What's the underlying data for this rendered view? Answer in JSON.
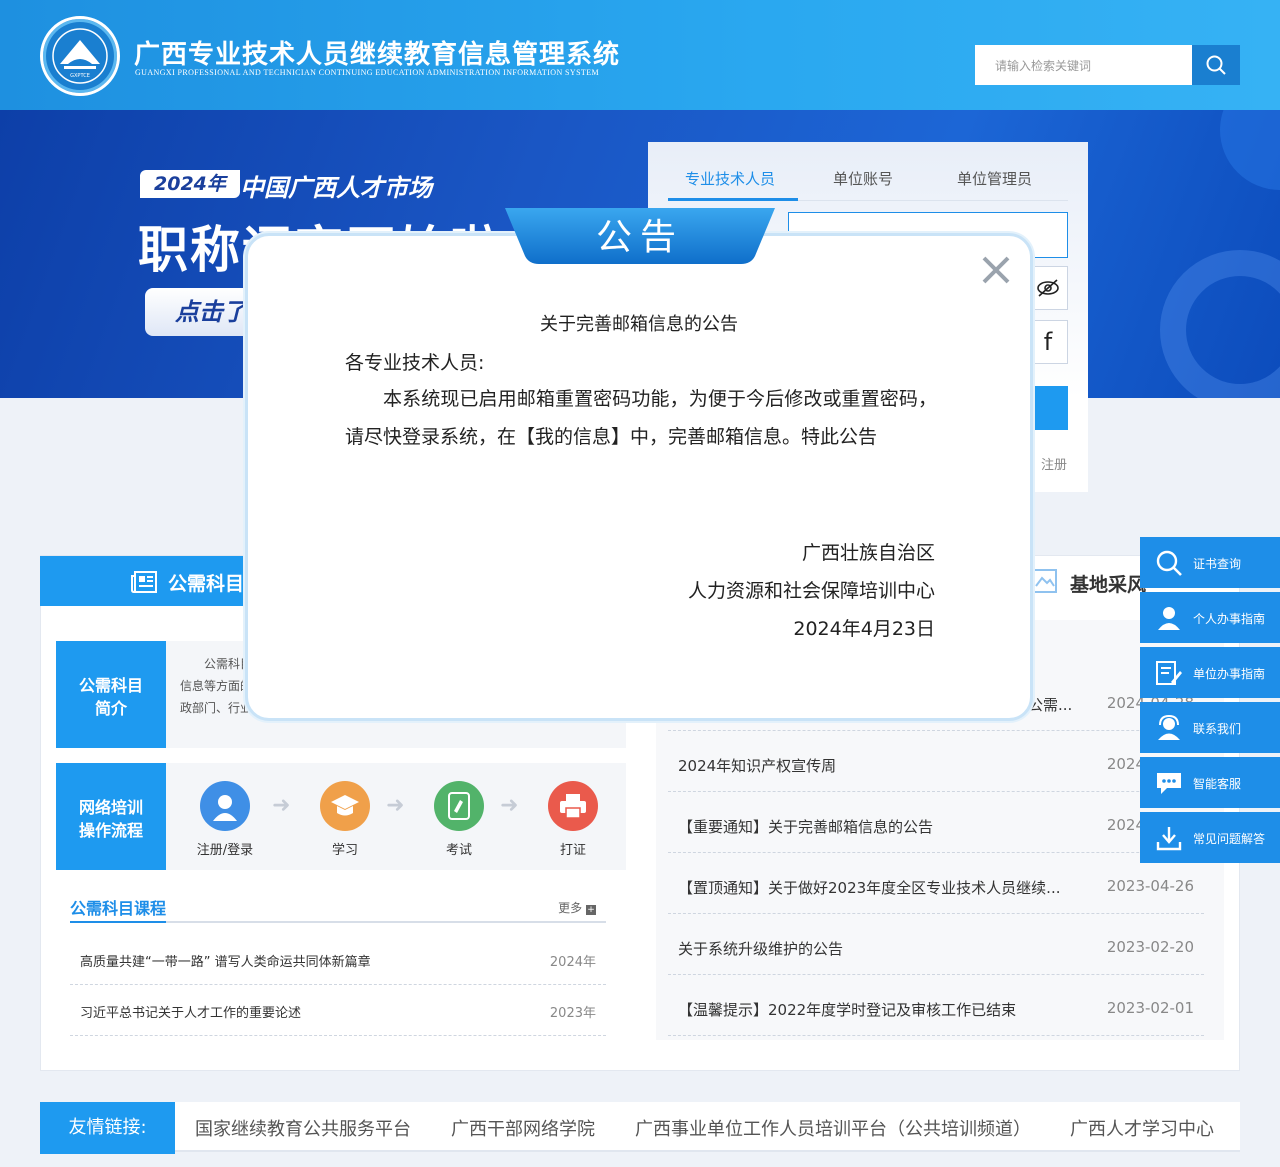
{
  "header": {
    "title": "广西专业技术人员继续教育信息管理系统",
    "subtitle": "GUANGXI PROFESSIONAL AND TECHNICIAN CONTINUING EDUCATION ADMINISTRATION INFORMATION SYSTEM",
    "logo_text": "GXPTCE",
    "search_placeholder": "请输入检索关键词"
  },
  "banner": {
    "tag": "2024年",
    "line1": "中国广西人才市场",
    "line2": "职称评审开始啦",
    "button": "点击了解"
  },
  "login": {
    "tabs": [
      "专业技术人员",
      "单位账号",
      "单位管理员"
    ],
    "register": "注册"
  },
  "left_section": {
    "title": "公需科目",
    "intro_label": [
      "公需科目",
      "简介"
    ],
    "intro_text": [
      "公需科目",
      "信息等方面的",
      "政部门、行业组"
    ],
    "flow_label": [
      "网络培训",
      "操作流程"
    ],
    "steps": [
      "注册/登录",
      "学习",
      "考试",
      "打证"
    ],
    "courses_title": "公需科目课程",
    "more": "更多",
    "courses": [
      {
        "title": "高质量共建“一带一路” 谱写人类命运共同体新篇章",
        "date": "2024年"
      },
      {
        "title": "习近平总书记关于人才工作的重要论述",
        "date": "2023年"
      }
    ]
  },
  "right_section": {
    "title": "基地采风",
    "news": [
      {
        "title": "公需...",
        "date": "2024-04-28"
      },
      {
        "title": "2024年知识产权宣传周",
        "date": "2024-04-26"
      },
      {
        "title": "【重要通知】关于完善邮箱信息的公告",
        "date": "2024-04-23"
      },
      {
        "title": "【置顶通知】关于做好2023年度全区专业技术人员继续...",
        "date": "2023-04-26"
      },
      {
        "title": "关于系统升级维护的公告",
        "date": "2023-02-20"
      },
      {
        "title": "【温馨提示】2022年度学时登记及审核工作已结束",
        "date": "2023-02-01"
      }
    ]
  },
  "side_menu": [
    "证书查询",
    "个人办事指南",
    "单位办事指南",
    "联系我们",
    "智能客服",
    "常见问题解答"
  ],
  "links": {
    "label": "友情链接:",
    "items": [
      "国家继续教育公共服务平台",
      "广西干部网络学院",
      "广西事业单位工作人员培训平台（公共培训频道）",
      "广西人才学习中心"
    ]
  },
  "modal": {
    "tab": "公告",
    "title": "关于完善邮箱信息的公告",
    "greeting": "各专业技术人员:",
    "body": "本系统现已启用邮箱重置密码功能，为便于今后修改或重置密码，请尽快登录系统，在【我的信息】中，完善邮箱信息。特此公告",
    "sign1": "广西壮族自治区",
    "sign2": "人力资源和社会保障培训中心",
    "date": "2024年4月23日"
  },
  "colors": {
    "primary": "#1e9af0",
    "header": "#2aa8f0",
    "banner": "#1a56c4"
  }
}
